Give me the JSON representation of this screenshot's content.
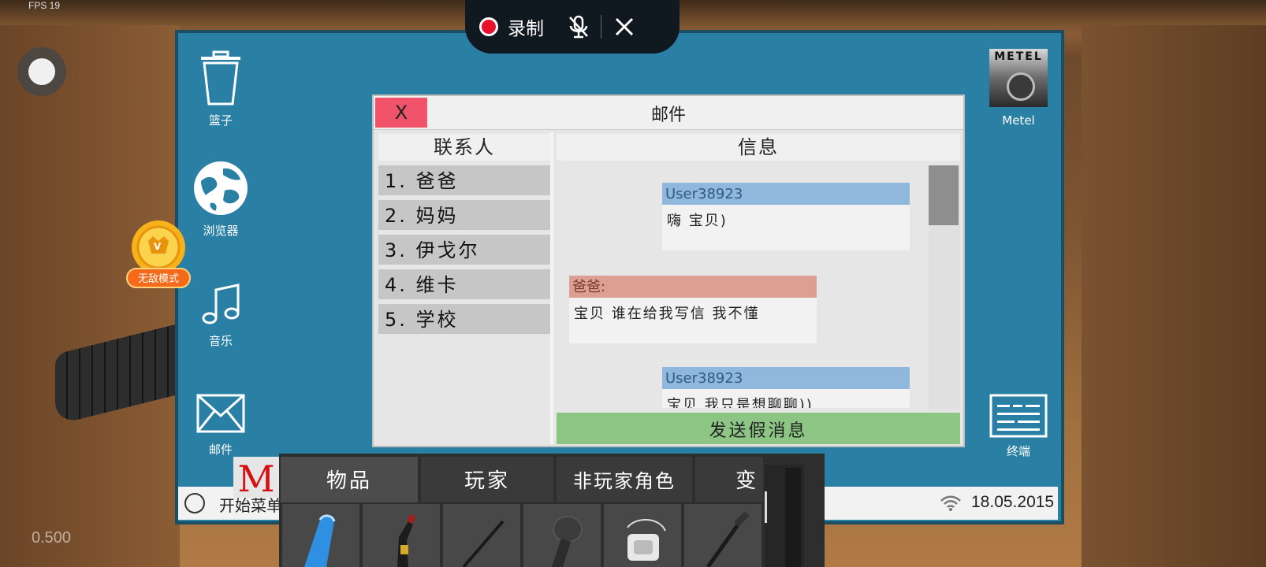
{
  "overlay": {
    "fps": "FPS 19",
    "zoom": "0.500"
  },
  "recorder": {
    "label": "录制"
  },
  "desktop": {
    "icons": [
      {
        "label": "篮子"
      },
      {
        "label": "浏览器"
      },
      {
        "label": "音乐"
      },
      {
        "label": "邮件"
      },
      {
        "label": "Metel"
      },
      {
        "label": "终端"
      }
    ],
    "metel_brand": "METEL"
  },
  "coin_badge": {
    "label": "无敌模式",
    "glyph": "V"
  },
  "mail": {
    "close_label": "X",
    "title": "邮件",
    "contacts_header": "联系人",
    "contacts": [
      "1. 爸爸",
      "2. 妈妈",
      "3. 伊戈尔",
      "4. 维卡",
      "5. 学校"
    ],
    "messages_header": "信息",
    "messages": [
      {
        "sender": "User38923",
        "text": "嗨 宝贝)"
      },
      {
        "sender": "爸爸:",
        "text": "宝贝 谁在给我写信 我不懂"
      },
      {
        "sender": "User38923",
        "text": "宝贝 我只是想聊聊))"
      }
    ],
    "send_button": "发送假消息"
  },
  "taskbar": {
    "start_label": "开始菜单",
    "date": "18.05.2015"
  },
  "game_menu": {
    "logo": "M",
    "tabs": [
      "物品",
      "玩家",
      "非玩家角色",
      "变"
    ]
  },
  "colors": {
    "desktop_bg": "#2a7fa4",
    "close_red": "#f0536a",
    "user_bar": "#90b8dc",
    "dad_bar": "#dca092",
    "send_green": "#8cc584"
  }
}
